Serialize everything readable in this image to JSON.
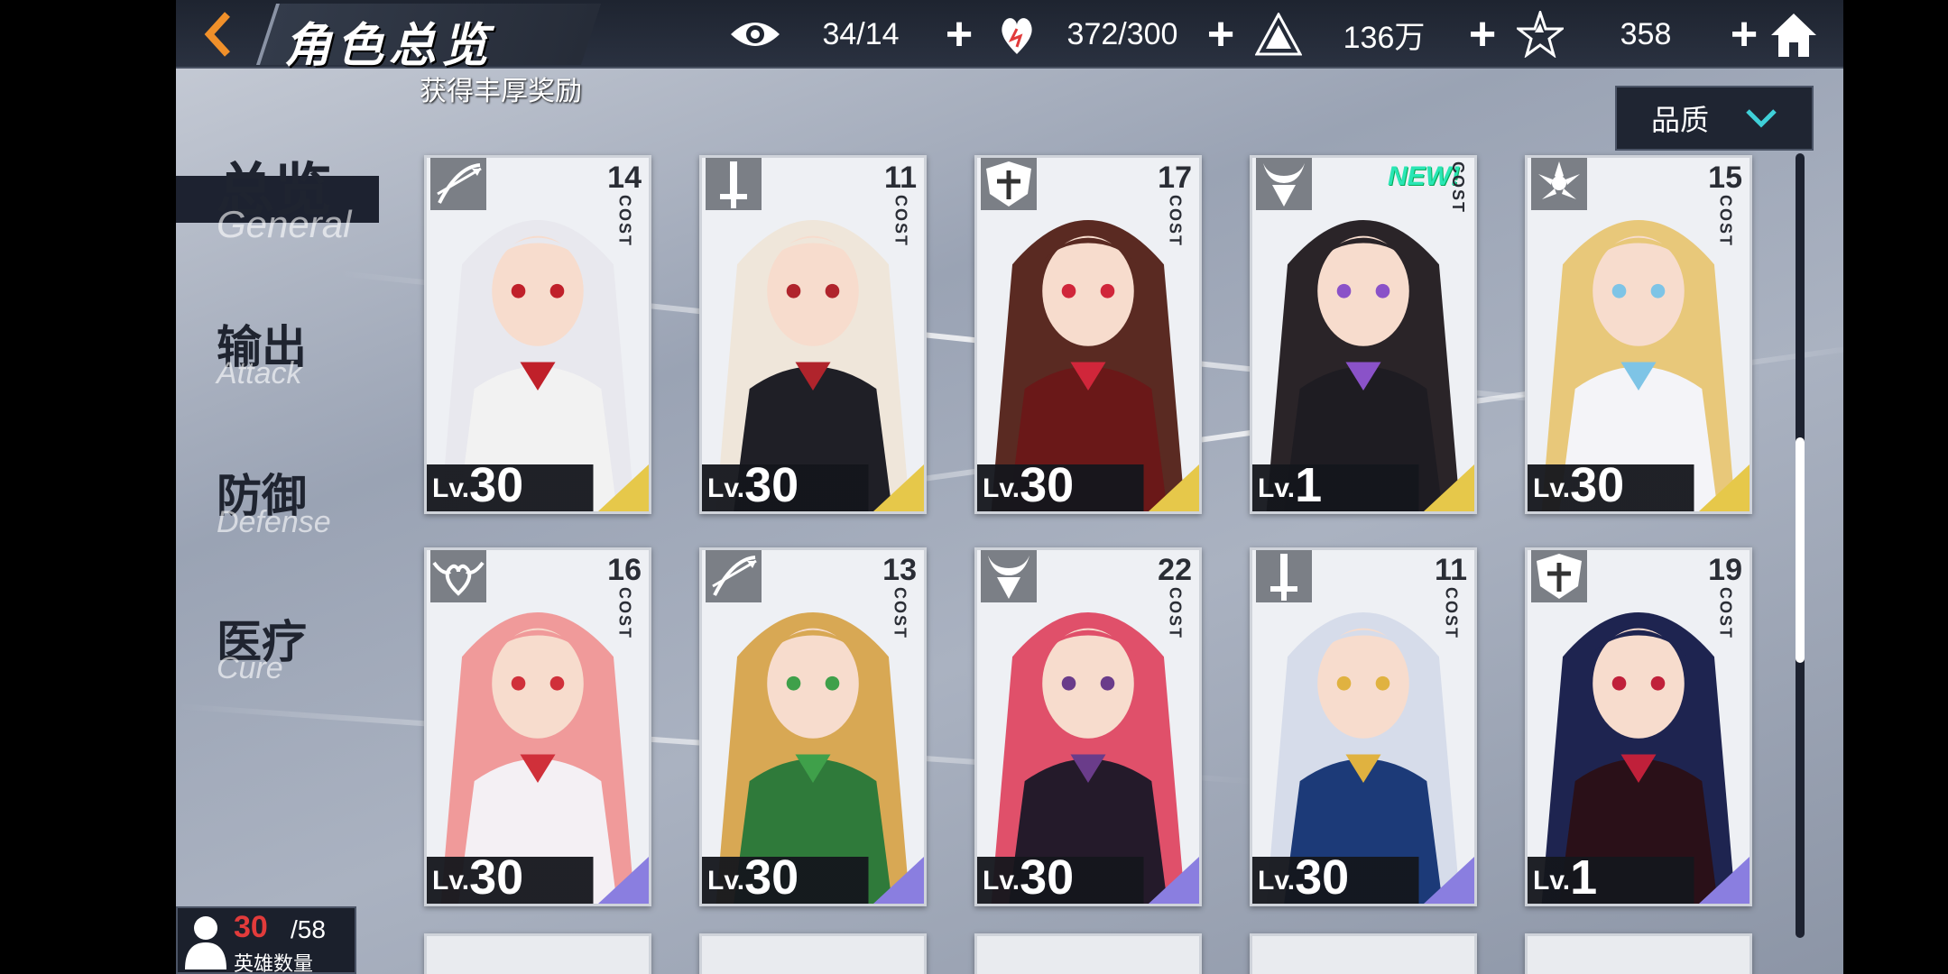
{
  "header": {
    "title": "角色总览",
    "back_icon": "back-arrow-icon",
    "home_icon": "home-icon"
  },
  "resources": [
    {
      "name": "vision",
      "icon": "eye-icon",
      "value": "34/14"
    },
    {
      "name": "stamina",
      "icon": "heart-icon",
      "value": "372/300"
    },
    {
      "name": "gold",
      "icon": "pyramid-coin-icon",
      "value": "136万"
    },
    {
      "name": "crystal",
      "icon": "star-crystal-icon",
      "value": "358"
    }
  ],
  "ticker": "获得丰厚奖励",
  "filter": {
    "label": "品质",
    "icon": "chevron-down-icon"
  },
  "sidebar": [
    {
      "cn": "总览",
      "en": "General",
      "active": true
    },
    {
      "cn": "输出",
      "en": "Attack",
      "active": false
    },
    {
      "cn": "防御",
      "en": "Defense",
      "active": false
    },
    {
      "cn": "医疗",
      "en": "Cure",
      "active": false
    }
  ],
  "cost_label": "COST",
  "level_prefix": "Lv.",
  "new_badge": "NEW!",
  "heroes": [
    {
      "cost": "14",
      "level": "30",
      "class_icon": "bow-icon",
      "rarity": "gold",
      "hair": "#e8e8ee",
      "outfit": "#f2f2f2",
      "accent": "#c0202a",
      "is_new": false
    },
    {
      "cost": "11",
      "level": "30",
      "class_icon": "sword-icon",
      "rarity": "gold",
      "hair": "#efe6da",
      "outfit": "#1f1f26",
      "accent": "#b0242c",
      "is_new": false
    },
    {
      "cost": "17",
      "level": "30",
      "class_icon": "shield-icon",
      "rarity": "gold",
      "hair": "#5a2a22",
      "outfit": "#6a1818",
      "accent": "#d0263a",
      "is_new": false
    },
    {
      "cost": "",
      "level": "1",
      "class_icon": "demon-icon",
      "rarity": "gold",
      "hair": "#2a2428",
      "outfit": "#1e1c22",
      "accent": "#8a52c8",
      "is_new": true
    },
    {
      "cost": "15",
      "level": "30",
      "class_icon": "lotus-icon",
      "rarity": "gold",
      "hair": "#e8c87a",
      "outfit": "#f4f4f8",
      "accent": "#7ec4e6",
      "is_new": false
    },
    {
      "cost": "16",
      "level": "30",
      "class_icon": "heart-wing-icon",
      "rarity": "purple",
      "hair": "#f09a9a",
      "outfit": "#f4f0f4",
      "accent": "#d0303a",
      "is_new": false
    },
    {
      "cost": "13",
      "level": "30",
      "class_icon": "bow-icon",
      "rarity": "purple",
      "hair": "#d8a854",
      "outfit": "#2f7a3a",
      "accent": "#3fa04a",
      "is_new": false
    },
    {
      "cost": "22",
      "level": "30",
      "class_icon": "demon-icon",
      "rarity": "purple",
      "hair": "#e0506a",
      "outfit": "#241a2a",
      "accent": "#6a3c8a",
      "is_new": false
    },
    {
      "cost": "11",
      "level": "30",
      "class_icon": "sword-icon",
      "rarity": "purple",
      "hair": "#d6dcea",
      "outfit": "#1c3a78",
      "accent": "#e0b240",
      "is_new": false
    },
    {
      "cost": "19",
      "level": "1",
      "class_icon": "shield-icon",
      "rarity": "purple",
      "hair": "#1e2450",
      "outfit": "#2a1018",
      "accent": "#c0203a",
      "is_new": false
    }
  ],
  "hero_count": {
    "current": "30",
    "total": "/58",
    "label": "英雄数量",
    "icon": "person-icon"
  },
  "colors": {
    "gold_rarity": "#e6c84a",
    "purple_rarity": "#8a7ee0",
    "topbar": "#1e2430",
    "accent_text": "#e23b3b"
  }
}
